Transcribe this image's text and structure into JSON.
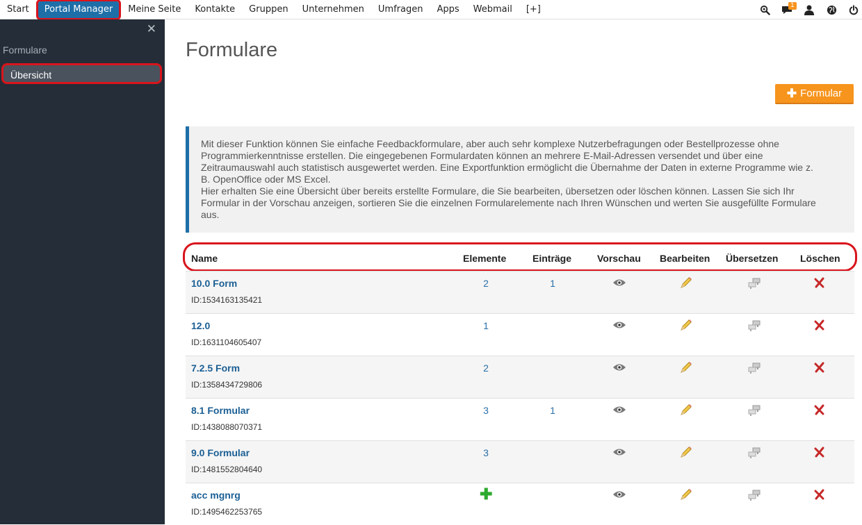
{
  "topnav": {
    "items": [
      "Start",
      "Portal Manager",
      "Meine Seite",
      "Kontakte",
      "Gruppen",
      "Unternehmen",
      "Umfragen",
      "Apps",
      "Webmail",
      "[+]"
    ],
    "active": "Portal Manager",
    "notification_count": "1"
  },
  "sidebar": {
    "section": "Formulare",
    "entry": "Übersicht"
  },
  "main": {
    "title": "Formulare",
    "add_button": "Formular",
    "info_lines": [
      "Mit dieser Funktion können Sie einfache Feedbackformulare, aber auch sehr komplexe Nutzerbefragungen oder Bestellprozesse ohne",
      "Programmierkenntnisse erstellen. Die eingegebenen Formulardaten können an mehrere E-Mail-Adressen versendet und über eine",
      "Zeitraumauswahl auch statistisch ausgewertet werden. Eine Exportfunktion ermöglicht die Übernahme der Daten in externe Programme wie z.",
      "B. OpenOffice oder MS Excel.",
      "Hier erhalten Sie eine Übersicht über bereits erstellte Formulare, die Sie bearbeiten, übersetzen oder löschen können. Lassen Sie sich Ihr",
      "Formular in der Vorschau anzeigen, sortieren Sie die einzelnen Formularelemente nach Ihren Wünschen und werten Sie ausgefüllte Formulare",
      "aus."
    ]
  },
  "table": {
    "headers": {
      "name": "Name",
      "elemente": "Elemente",
      "eintraege": "Einträge",
      "vorschau": "Vorschau",
      "bearbeiten": "Bearbeiten",
      "uebersetzen": "Übersetzen",
      "loeschen": "Löschen"
    },
    "rows": [
      {
        "name": "10.0 Form",
        "id": "ID:1534163135421",
        "elemente": "2",
        "eintraege": "1"
      },
      {
        "name": "12.0",
        "id": "ID:1631104605407",
        "elemente": "1",
        "eintraege": ""
      },
      {
        "name": "7.2.5 Form",
        "id": "ID:1358434729806",
        "elemente": "2",
        "eintraege": ""
      },
      {
        "name": "8.1 Formular",
        "id": "ID:1438088070371",
        "elemente": "3",
        "eintraege": "1"
      },
      {
        "name": "9.0 Formular",
        "id": "ID:1481552804640",
        "elemente": "3",
        "eintraege": ""
      },
      {
        "name": "acc mgnrg",
        "id": "ID:1495462253765",
        "elemente": "",
        "eintraege": "",
        "elemente_icon": "add-icon"
      }
    ]
  },
  "colors": {
    "accent": "#1e6fa8",
    "highlight": "#d9141c",
    "button": "#f7941d",
    "sidebar": "#252d38"
  }
}
